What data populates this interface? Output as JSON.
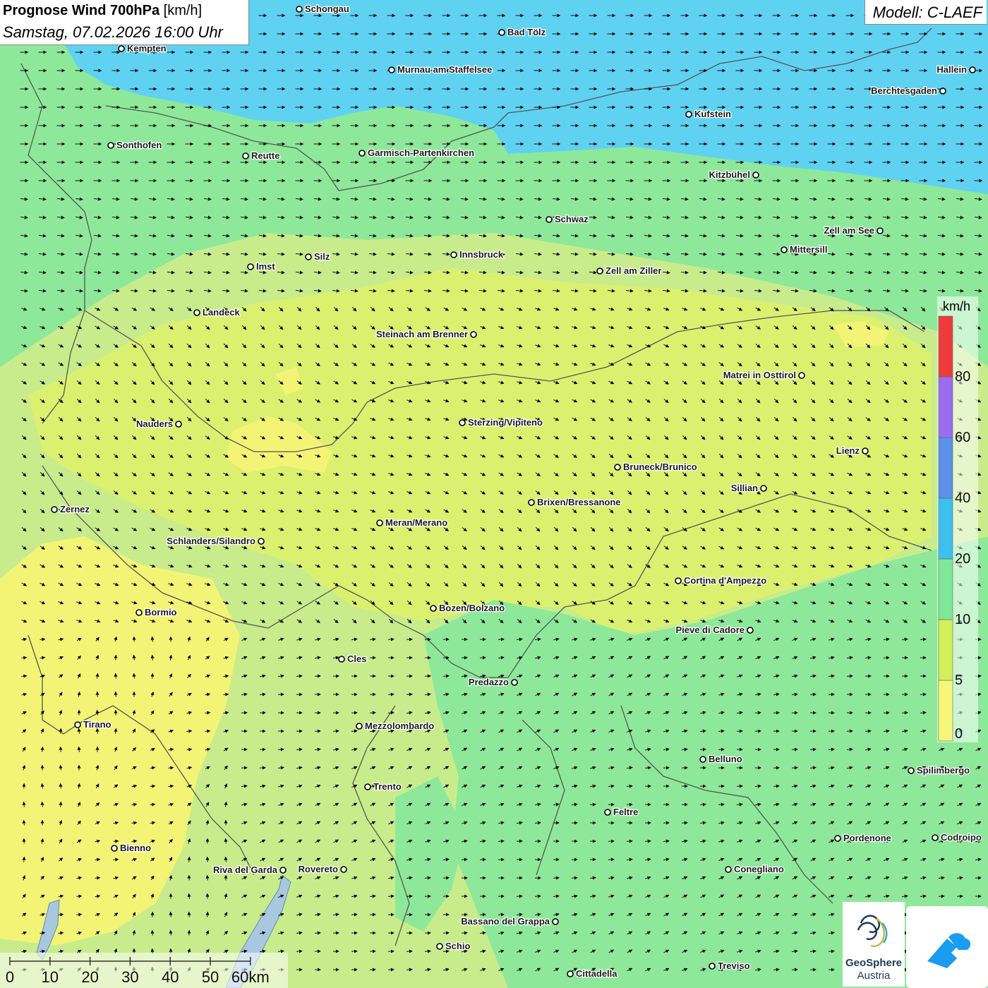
{
  "title": {
    "bold": "Prognose Wind 700hPa",
    "unit": " [km/h]",
    "datetime": "Samstag, 07.02.2026 16:00 Uhr"
  },
  "model": "Modell: C-LAEF",
  "legend": {
    "unit": "km/h",
    "levels": [
      "0",
      "5",
      "10",
      "20",
      "40",
      "60",
      "80"
    ],
    "colors": [
      "#f6f778",
      "#d2f058",
      "#7ee896",
      "#3ec0ee",
      "#5a90e8",
      "#9a6cf0",
      "#ee3c3c"
    ]
  },
  "scale": {
    "ticks": [
      "0",
      "10",
      "20",
      "30",
      "40",
      "50",
      "60km"
    ]
  },
  "cities": [
    {
      "name": "Schongau"
    },
    {
      "name": "Bad Tölz"
    },
    {
      "name": "Kempten"
    },
    {
      "name": "Murnau am Staffelsee"
    },
    {
      "name": "Hallein"
    },
    {
      "name": "Berchtesgaden"
    },
    {
      "name": "Kufstein"
    },
    {
      "name": "Sonthofen"
    },
    {
      "name": "Reutte"
    },
    {
      "name": "Garmisch-Partenkirchen"
    },
    {
      "name": "Kitzbühel"
    },
    {
      "name": "Schwaz"
    },
    {
      "name": "Zell am See"
    },
    {
      "name": "Innsbruck"
    },
    {
      "name": "Mittersill"
    },
    {
      "name": "Silz"
    },
    {
      "name": "Imst"
    },
    {
      "name": "Zell am Ziller"
    },
    {
      "name": "Landeck"
    },
    {
      "name": "Steinach am Brenner"
    },
    {
      "name": "Matrei in Osttirol"
    },
    {
      "name": "Nauders"
    },
    {
      "name": "Sterzing/Vipiteno"
    },
    {
      "name": "Lienz"
    },
    {
      "name": "Bruneck/Brunico"
    },
    {
      "name": "Sillian"
    },
    {
      "name": "Zernez"
    },
    {
      "name": "Brixen/Bressanone"
    },
    {
      "name": "Meran/Merano"
    },
    {
      "name": "Schlanders/Silandro"
    },
    {
      "name": "Cortina d'Ampezzo"
    },
    {
      "name": "Bozen/Bolzano"
    },
    {
      "name": "Bormio"
    },
    {
      "name": "Pieve di Cadore"
    },
    {
      "name": "Cles"
    },
    {
      "name": "Predazzo"
    },
    {
      "name": "Tirano"
    },
    {
      "name": "Mezzolombardo"
    },
    {
      "name": "Belluno"
    },
    {
      "name": "Spilimbergo"
    },
    {
      "name": "Trento"
    },
    {
      "name": "Feltre"
    },
    {
      "name": "Pordenone"
    },
    {
      "name": "Codroipo"
    },
    {
      "name": "Bienno"
    },
    {
      "name": "Riva del Garda"
    },
    {
      "name": "Rovereto"
    },
    {
      "name": "Conegliano"
    },
    {
      "name": "Bassano del Grappa"
    },
    {
      "name": "Schio"
    },
    {
      "name": "Treviso"
    },
    {
      "name": "Cittadella"
    }
  ],
  "logos": {
    "geosphere_name": "GeoSphere",
    "geosphere_sub": "Austria"
  },
  "colors": {
    "strong": "#5fd2f2",
    "moderate": "#7ee896",
    "light": "#c8ec8c",
    "calm": "#f3f475",
    "yellowgreen": "#dcf070"
  }
}
